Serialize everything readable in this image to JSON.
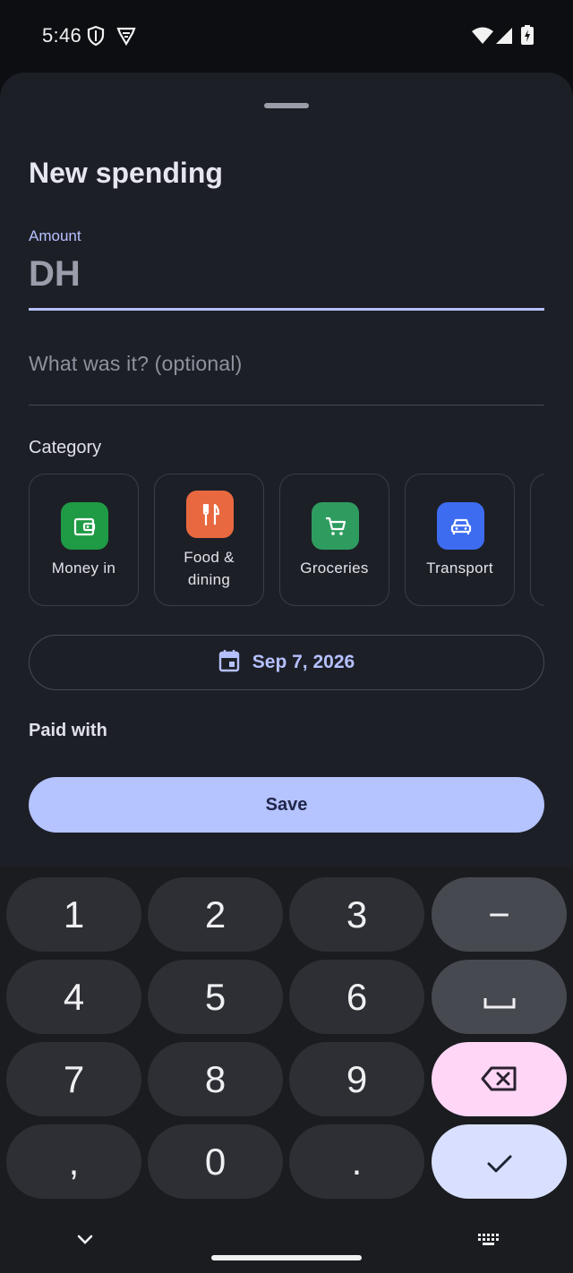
{
  "status_bar": {
    "time": "5:46"
  },
  "sheet": {
    "title": "New spending",
    "amount": {
      "label": "Amount",
      "value": "DH"
    },
    "description": {
      "placeholder": "What was it? (optional)"
    },
    "category": {
      "heading": "Category",
      "items": [
        {
          "line1": "Money in",
          "line2": "",
          "icon": "wallet-icon",
          "color": "#1f9a45"
        },
        {
          "line1": "Food &",
          "line2": "dining",
          "icon": "fork-knife-icon",
          "color": "#e8693f"
        },
        {
          "line1": "Groceries",
          "line2": "",
          "icon": "cart-icon",
          "color": "#2f9c5f"
        },
        {
          "line1": "Transport",
          "line2": "",
          "icon": "car-icon",
          "color": "#3d6cf0"
        }
      ]
    },
    "date": {
      "label": "Sep 7, 2026"
    },
    "paid_with": {
      "heading": "Paid with"
    },
    "save": {
      "label": "Save"
    }
  },
  "keyboard": {
    "keys": [
      "1",
      "2",
      "3",
      "−",
      "4",
      "5",
      "6",
      "␣",
      "7",
      "8",
      "9",
      "⌫",
      ",",
      "0",
      ".",
      "✓"
    ]
  },
  "colors": {
    "accent": "#b5c1ff",
    "sheet_bg": "#1d1f27",
    "save_bg": "#b5c3ff"
  }
}
